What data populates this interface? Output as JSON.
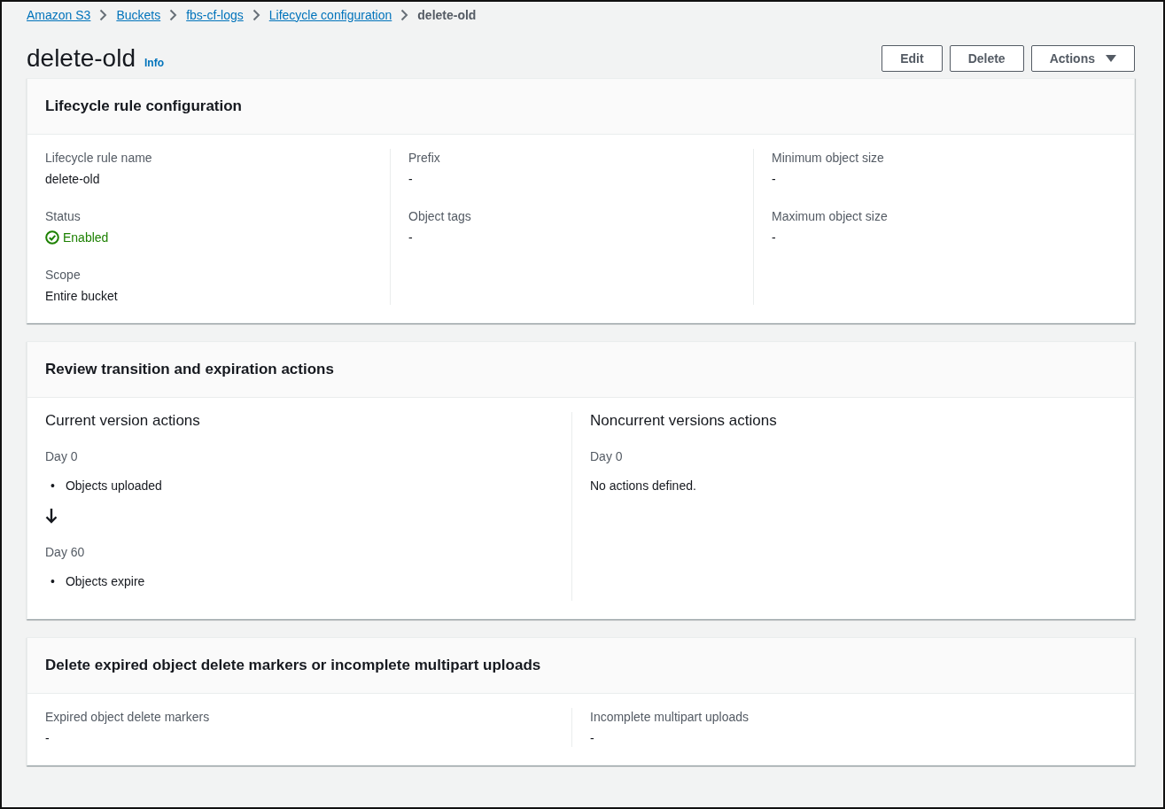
{
  "breadcrumb": [
    {
      "label": "Amazon S3",
      "kind": "link"
    },
    {
      "label": "Buckets",
      "kind": "link"
    },
    {
      "label": "fbs-cf-logs",
      "kind": "link"
    },
    {
      "label": "Lifecycle configuration",
      "kind": "link"
    },
    {
      "label": "delete-old",
      "kind": "current"
    }
  ],
  "page": {
    "title": "delete-old",
    "info": "Info"
  },
  "buttons": [
    {
      "label": "Edit",
      "kind": "plain"
    },
    {
      "label": "Delete",
      "kind": "plain"
    },
    {
      "label": "Actions",
      "kind": "dropdown"
    }
  ],
  "rule_configuration": {
    "title": "Lifecycle rule configuration",
    "columns": [
      [
        {
          "label": "Lifecycle rule name",
          "value": "delete-old",
          "kind": "text"
        },
        {
          "label": "Status",
          "value": "Enabled",
          "kind": "status"
        },
        {
          "label": "Scope",
          "value": "Entire bucket",
          "kind": "text"
        }
      ],
      [
        {
          "label": "Prefix",
          "value": "-",
          "kind": "text"
        },
        {
          "label": "Object tags",
          "value": "-",
          "kind": "text"
        }
      ],
      [
        {
          "label": "Minimum object size",
          "value": "-",
          "kind": "text"
        },
        {
          "label": "Maximum object size",
          "value": "-",
          "kind": "text"
        }
      ]
    ]
  },
  "review": {
    "title": "Review transition and expiration actions",
    "columns": [
      {
        "heading": "Current version actions",
        "steps": [
          {
            "day": "Day 0",
            "bullet": "•",
            "items": [
              "Objects uploaded"
            ]
          },
          {
            "day": "Day 60",
            "bullet": "•",
            "items": [
              "Objects expire"
            ]
          }
        ]
      },
      {
        "heading": "Noncurrent versions actions",
        "steps": [
          {
            "day": "Day 0",
            "note": "No actions defined."
          }
        ]
      }
    ]
  },
  "delete_markers": {
    "title": "Delete expired object delete markers or incomplete multipart uploads",
    "fields": [
      {
        "label": "Expired object delete markers",
        "value": "-"
      },
      {
        "label": "Incomplete multipart uploads",
        "value": "-"
      }
    ]
  }
}
